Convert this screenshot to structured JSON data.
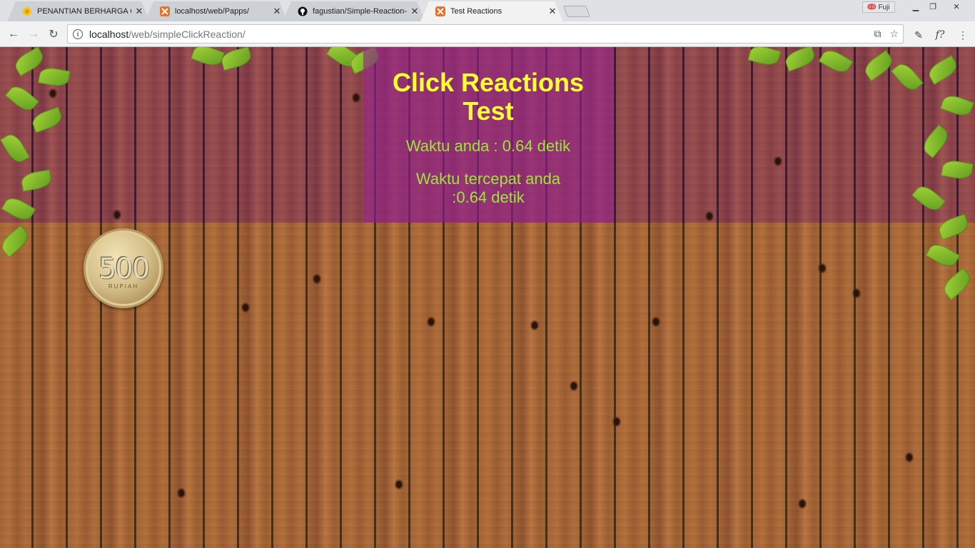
{
  "browser": {
    "tabs": [
      {
        "title": "PENANTIAN BERHARGA CH",
        "icon": "goldfish-icon",
        "active": false
      },
      {
        "title": "localhost/web/Papps/",
        "icon": "xampp-icon",
        "active": false
      },
      {
        "title": "fagustian/Simple-Reaction-",
        "icon": "github-icon",
        "active": false
      },
      {
        "title": "Test Reactions",
        "icon": "xampp-icon",
        "active": true
      }
    ],
    "profile_name": "Fuji",
    "url_host": "localhost",
    "url_path": "/web/simpleClickReaction/"
  },
  "page": {
    "title": "Click Reactions Test",
    "your_time": "Waktu anda : 0.64 detik",
    "best_time": "Waktu tercepat anda :0.64 detik",
    "coin_value": "500",
    "coin_unit": "RUPIAH"
  },
  "colors": {
    "title_yellow": "#ffff33",
    "text_green": "#9fe43c",
    "panel_purple": "#962387",
    "tab_favicon_orange": "#e5702a"
  }
}
